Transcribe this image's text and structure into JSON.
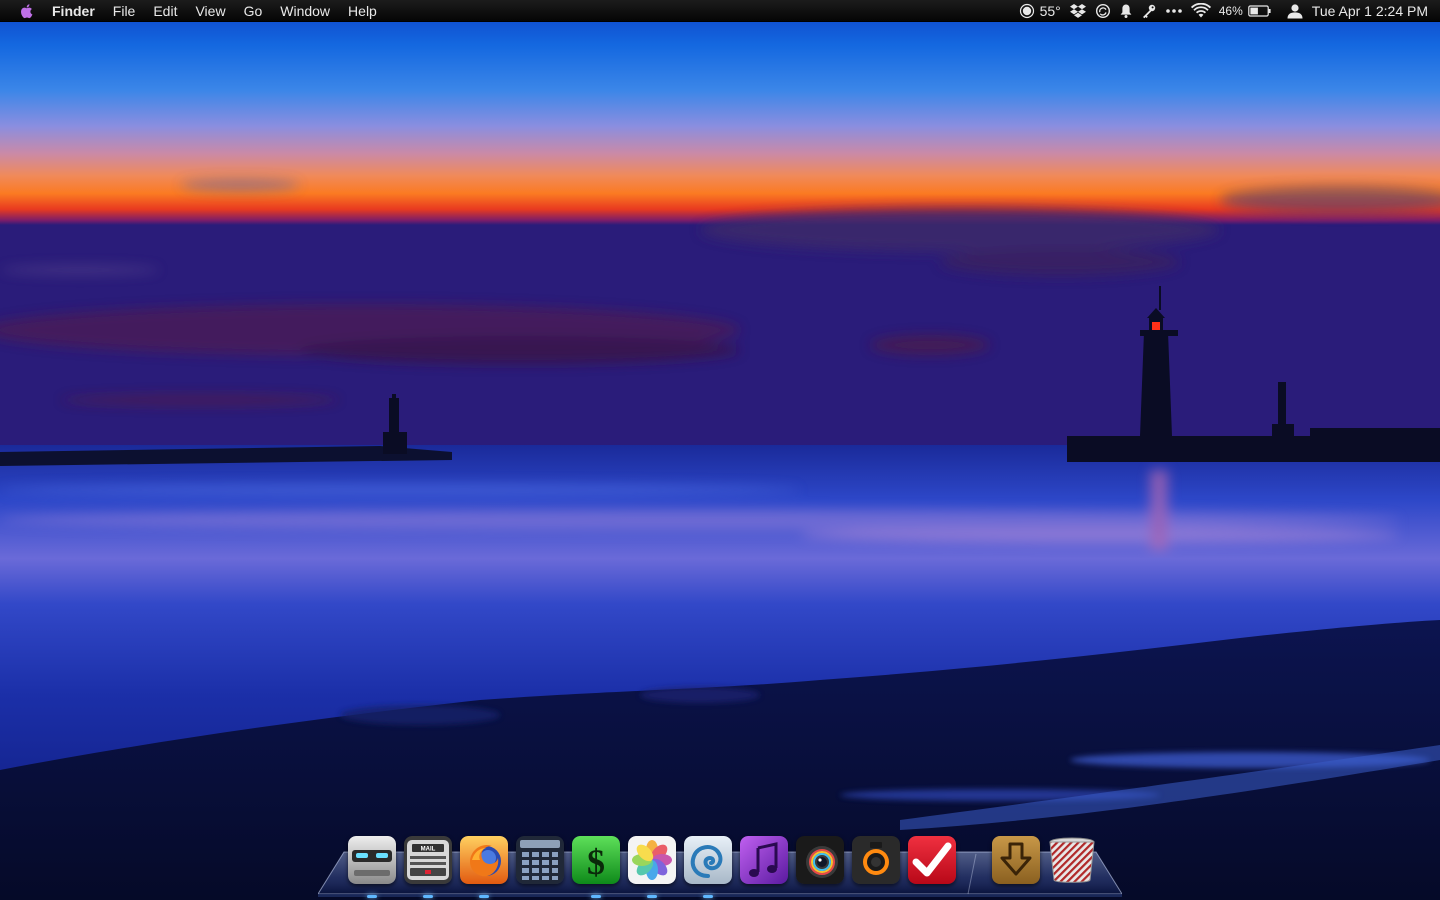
{
  "menubar": {
    "app_name": "Finder",
    "menus": [
      "File",
      "Edit",
      "View",
      "Go",
      "Window",
      "Help"
    ],
    "weather_temp": "55°",
    "battery_percent": "46%",
    "battery_level": 0.46,
    "clock": "Tue Apr 1  2:24 PM"
  },
  "status_icons": [
    "weather-icon",
    "dropbox-icon",
    "sync-icon",
    "notification-bell-icon",
    "key-icon",
    "more-dots-icon",
    "wifi-icon",
    "battery-icon",
    "user-icon"
  ],
  "dock": {
    "apps": [
      {
        "name": "finder-robot",
        "icon": "robot-face-icon",
        "running": true
      },
      {
        "name": "mail",
        "icon": "mail-icon",
        "label": "MAIL",
        "running": true
      },
      {
        "name": "firefox",
        "icon": "firefox-icon",
        "running": true
      },
      {
        "name": "calculator",
        "icon": "calculator-icon",
        "running": false
      },
      {
        "name": "money",
        "icon": "dollar-icon",
        "running": true
      },
      {
        "name": "photos",
        "icon": "photos-flower-icon",
        "running": true
      },
      {
        "name": "nautilus",
        "icon": "nautilus-shell-icon",
        "running": true
      },
      {
        "name": "music",
        "icon": "music-note-icon",
        "running": false
      },
      {
        "name": "aperture",
        "icon": "aperture-lens-icon",
        "running": false
      },
      {
        "name": "camera",
        "icon": "camera-icon",
        "running": false
      },
      {
        "name": "todo",
        "icon": "checkmark-icon",
        "running": false
      },
      {
        "name": "downloads",
        "icon": "download-arrow-icon",
        "running": false
      },
      {
        "name": "trash",
        "icon": "trash-icon",
        "running": false
      }
    ]
  },
  "colors": {
    "menubar_bg": "#0a0a0a",
    "menubar_text": "#e8e8e8",
    "apple_logo": "#c071e8",
    "running_indicator": "#5fb8ff"
  }
}
